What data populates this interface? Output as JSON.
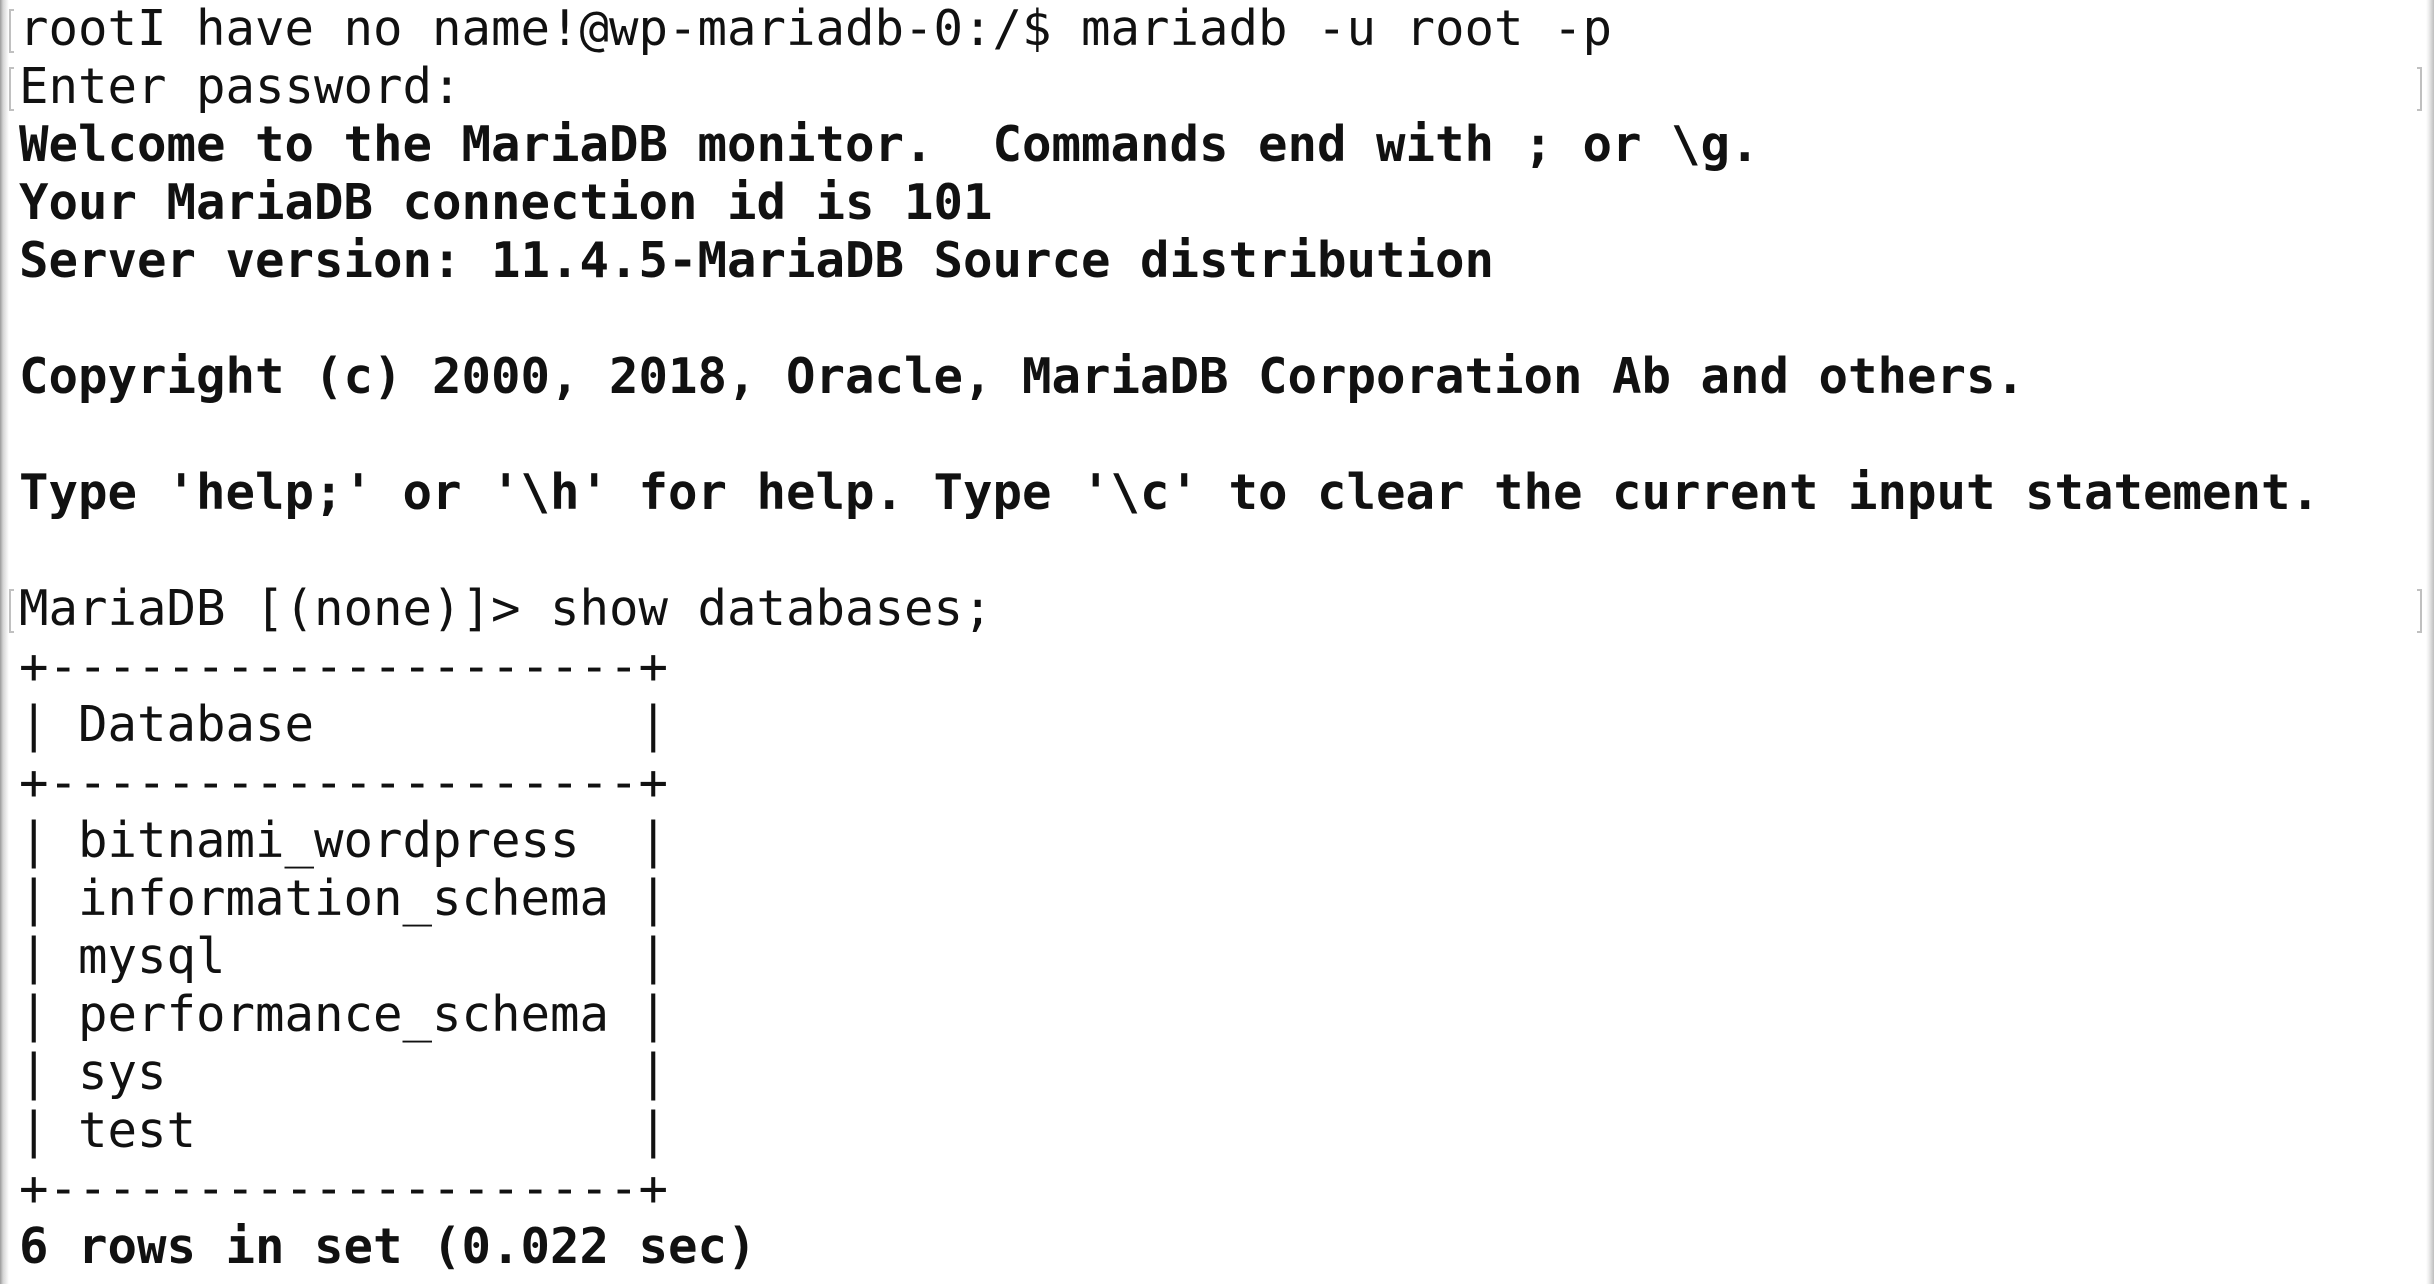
{
  "terminal": {
    "lines": [
      {
        "text": "rootI have no name!@wp-mariadb-0:/$ mariadb -u root -p",
        "bold": false
      },
      {
        "text": "Enter password:",
        "bold": false
      },
      {
        "text": "Welcome to the MariaDB monitor.  Commands end with ; or \\g.",
        "bold": true
      },
      {
        "text": "Your MariaDB connection id is 101",
        "bold": true
      },
      {
        "text": "Server version: 11.4.5-MariaDB Source distribution",
        "bold": true
      },
      {
        "text": "",
        "bold": true
      },
      {
        "text": "Copyright (c) 2000, 2018, Oracle, MariaDB Corporation Ab and others.",
        "bold": true
      },
      {
        "text": "",
        "bold": true
      },
      {
        "text": "Type 'help;' or '\\h' for help. Type '\\c' to clear the current input statement.",
        "bold": true
      },
      {
        "text": "",
        "bold": true
      },
      {
        "text": "MariaDB [(none)]> show databases;",
        "bold": false
      },
      {
        "text": "+--------------------+",
        "bold": false
      },
      {
        "text": "| Database           |",
        "bold": false
      },
      {
        "text": "+--------------------+",
        "bold": false
      },
      {
        "text": "| bitnami_wordpress  |",
        "bold": false
      },
      {
        "text": "| information_schema |",
        "bold": false
      },
      {
        "text": "| mysql              |",
        "bold": false
      },
      {
        "text": "| performance_schema |",
        "bold": false
      },
      {
        "text": "| sys                |",
        "bold": false
      },
      {
        "text": "| test               |",
        "bold": false
      },
      {
        "text": "+--------------------+",
        "bold": false
      },
      {
        "text": "6 rows in set (0.022 sec)",
        "bold": true
      }
    ]
  }
}
